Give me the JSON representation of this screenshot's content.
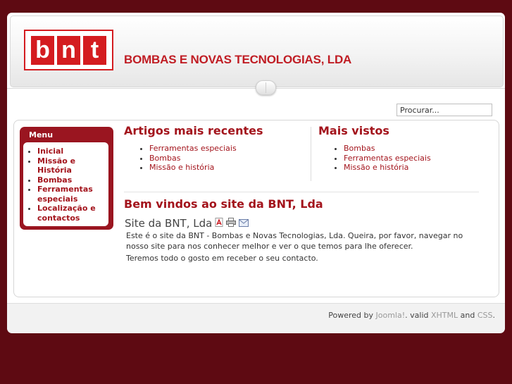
{
  "header": {
    "logo_letters": [
      "b",
      "n",
      "t"
    ],
    "company_name": "BOMBAS E NOVAS TECNOLOGIAS, LDA"
  },
  "search": {
    "placeholder": "Procurar..."
  },
  "menu": {
    "title": "Menu",
    "items": [
      {
        "label": "Inicial"
      },
      {
        "label": "Missão e História"
      },
      {
        "label": "Bombas"
      },
      {
        "label": "Ferramentas especiais"
      },
      {
        "label": "Localização e contactos"
      }
    ]
  },
  "recent": {
    "title": "Artigos mais recentes",
    "items": [
      "Ferramentas especiais",
      "Bombas",
      "Missão e história"
    ]
  },
  "popular": {
    "title": "Mais vistos",
    "items": [
      "Bombas",
      "Ferramentas especiais",
      "Missão e história"
    ]
  },
  "main": {
    "welcome": "Bem vindos ao site da BNT, Lda",
    "article_title": "Site da BNT, Lda",
    "paragraph1": "Este é o site da BNT - Bombas e Novas Tecnologias, Lda. Queira, por favor, navegar no nosso site para nos conhecer melhor e ver o que temos para lhe oferecer.",
    "paragraph2": "Teremos todo o gosto em receber o seu contacto.",
    "icons": [
      "pdf-icon",
      "print-icon",
      "email-icon"
    ]
  },
  "footer": {
    "powered_by": "Powered by",
    "joomla": "Joomla!",
    "valid": ". valid",
    "xhtml": "XHTML",
    "and": "and",
    "css": "CSS",
    "end": "."
  },
  "colors": {
    "background": "#5e0a12",
    "accent": "#a3141c",
    "logo_red": "#d41c20"
  }
}
